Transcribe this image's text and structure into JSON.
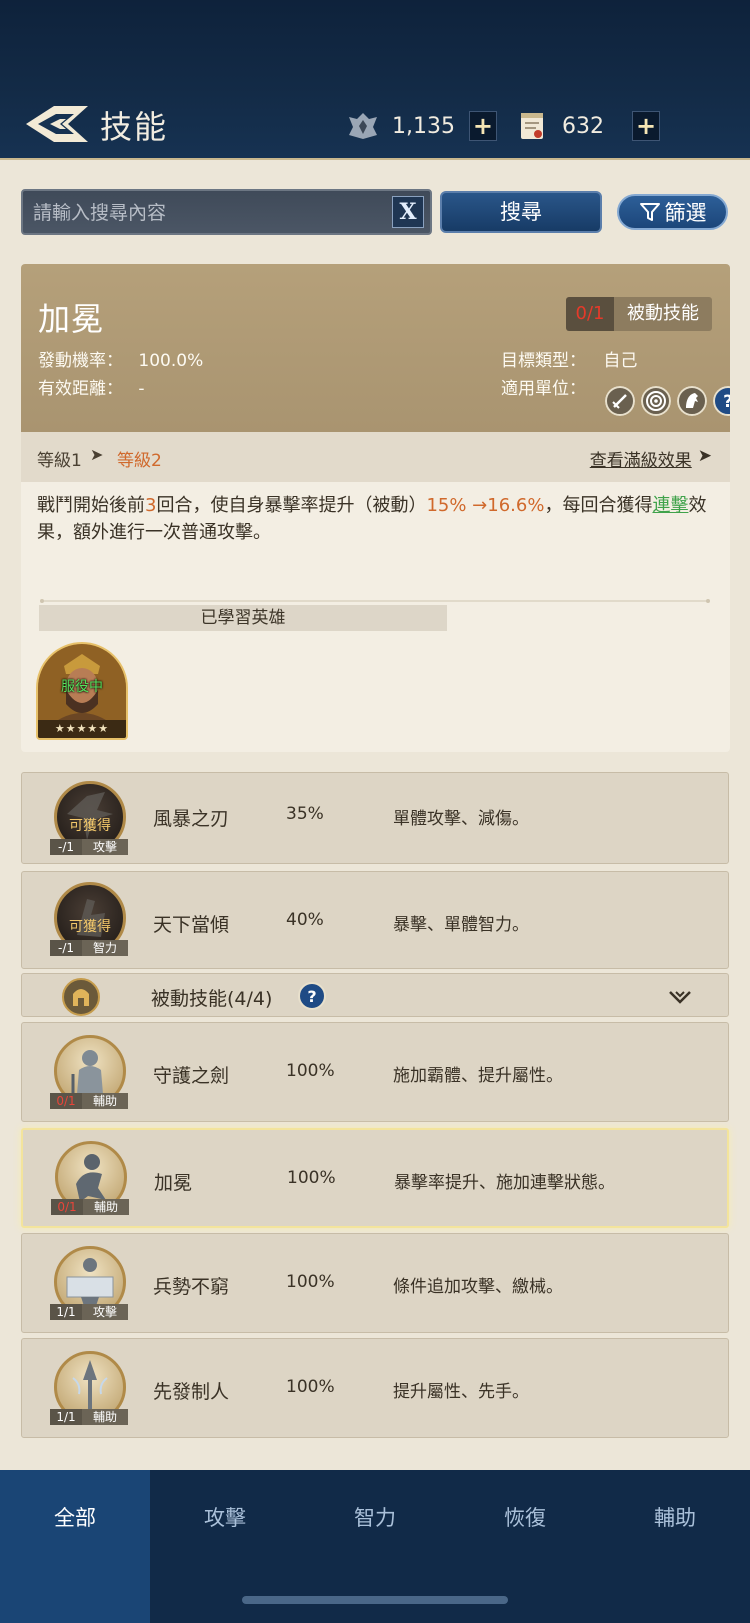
{
  "header": {
    "title": "技能",
    "resources": [
      {
        "icon": "crest-icon",
        "value": "1,135",
        "add": "+"
      },
      {
        "icon": "scroll-icon",
        "value": "632",
        "add": "+"
      }
    ]
  },
  "search": {
    "placeholder": "請輸入搜尋內容",
    "value": "",
    "clear_label": "X",
    "search_label": "搜尋",
    "filter_label": "篩選"
  },
  "detail": {
    "name": "加冕",
    "count": "0/1",
    "type": "被動技能",
    "trigger_rate_label": "發動機率：",
    "trigger_rate": "100.0%",
    "range_label": "有效距離：",
    "range": "-",
    "target_label": "目標類型：",
    "target": "自己",
    "units_label": "適用單位：",
    "units": [
      "sword-icon",
      "archer-target-icon",
      "cavalry-horse-icon",
      "question-icon"
    ],
    "level_from": "等級1",
    "level_to": "等級2",
    "max_label": "查看滿級效果",
    "desc": {
      "p1": "戰鬥開始後前",
      "n1": "3",
      "p2": "回合，使自身暴擊率提升（被動）",
      "n2": "15% →16.6%",
      "p3": "，每回合獲得",
      "link": "連擊",
      "p4": "效果，額外進行一次普通攻擊。"
    },
    "learned_title": "已學習英雄",
    "hero": {
      "status": "服役中",
      "stars": "★★★★★"
    }
  },
  "skills_top": [
    {
      "acq": "可獲得",
      "count": "-/1",
      "cat": "攻擊",
      "name": "風暴之刃",
      "rate": "35%",
      "effect": "單體攻擊、減傷。"
    },
    {
      "acq": "可獲得",
      "count": "-/1",
      "cat": "智力",
      "name": "天下當傾",
      "rate": "40%",
      "effect": "暴擊、單體智力。"
    }
  ],
  "passive_section": {
    "title": "被動技能(4/4)"
  },
  "skills_passive": [
    {
      "count": "0/1",
      "cat": "輔助",
      "name": "守護之劍",
      "rate": "100%",
      "effect": "施加霸體、提升屬性。"
    },
    {
      "count": "0/1",
      "cat": "輔助",
      "name": "加冕",
      "rate": "100%",
      "effect": "暴擊率提升、施加連擊狀態。"
    },
    {
      "count": "1/1",
      "cat": "攻擊",
      "name": "兵勢不窮",
      "rate": "100%",
      "effect": "條件追加攻擊、繳械。"
    },
    {
      "count": "1/1",
      "cat": "輔助",
      "name": "先發制人",
      "rate": "100%",
      "effect": "提升屬性、先手。"
    }
  ],
  "tabs": [
    "全部",
    "攻擊",
    "智力",
    "恢復",
    "輔助"
  ],
  "colors": {
    "accent_orange": "#d0692c",
    "link_green": "#3fa24a",
    "nav_active": "#1a4575",
    "header_gold": "#b5a07a"
  }
}
